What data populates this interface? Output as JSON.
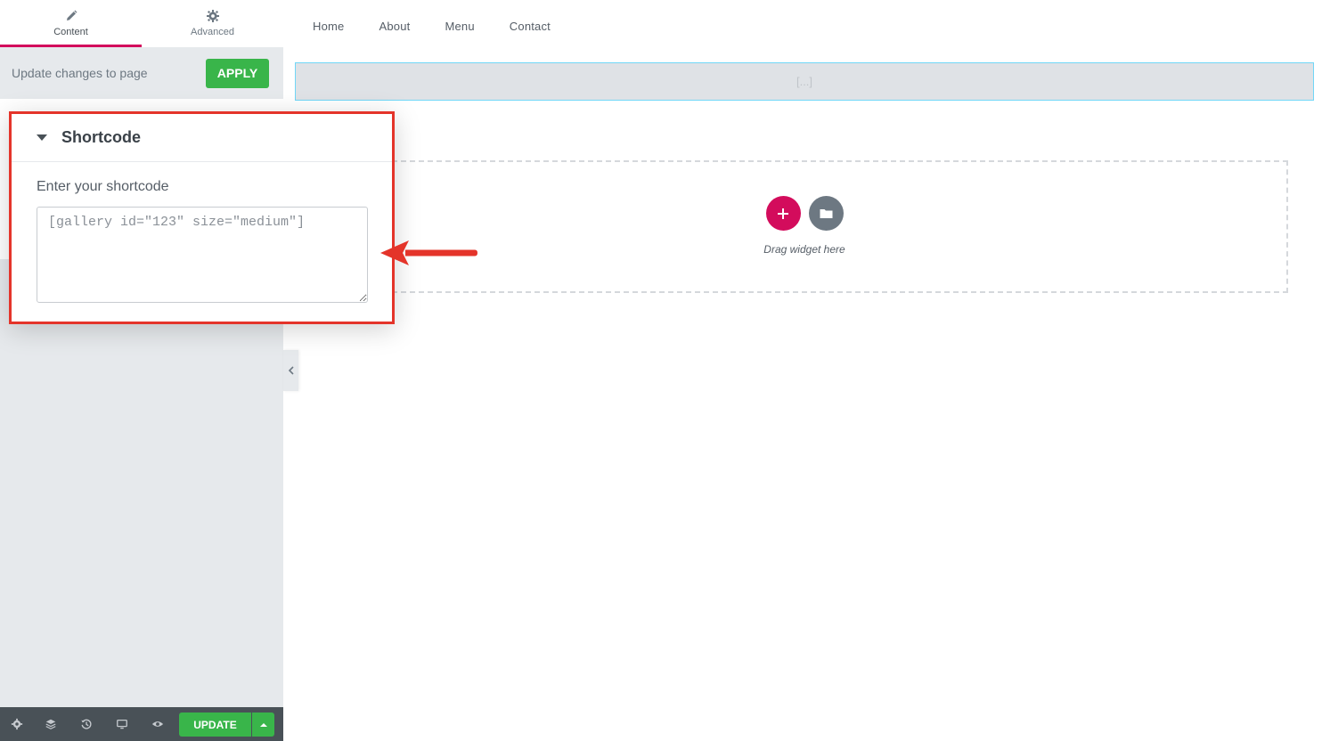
{
  "panel": {
    "tabs": [
      {
        "label": "Content",
        "icon": "pencil-icon",
        "active": true
      },
      {
        "label": "Advanced",
        "icon": "gear-icon",
        "active": false
      }
    ],
    "apply_label": "Update changes to page",
    "apply_button": "APPLY"
  },
  "popout": {
    "title": "Shortcode",
    "field_label": "Enter your shortcode",
    "field_placeholder": "[gallery id=\"123\" size=\"medium\"]",
    "field_value": ""
  },
  "canvas": {
    "nav": [
      "Home",
      "About",
      "Menu",
      "Contact"
    ],
    "shortcode_placeholder": "[...]",
    "drop_text": "Drag widget here"
  },
  "footer": {
    "icons": [
      "settings-icon",
      "layers-icon",
      "history-icon",
      "responsive-icon",
      "preview-icon"
    ],
    "update_button": "UPDATE"
  },
  "colors": {
    "accent": "#d30c5c",
    "apply_green": "#39b54a",
    "highlight_red": "#e4342a",
    "panel_bg": "#e6e9ec",
    "footer_bg": "#495157"
  }
}
